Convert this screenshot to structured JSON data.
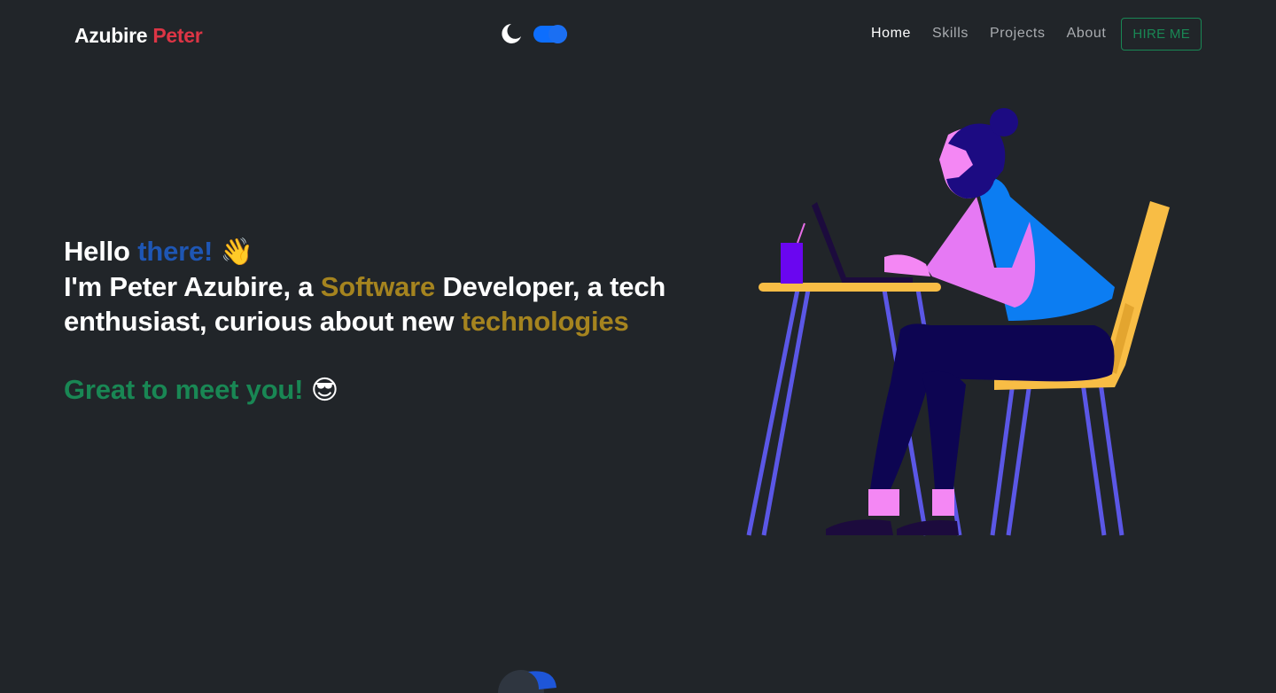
{
  "brand": {
    "first": "Azubire",
    "last": "Peter"
  },
  "theme_toggle": {
    "icon": "moon-icon",
    "state": "on",
    "color": "#0d6efd"
  },
  "nav": {
    "items": [
      {
        "label": "Home",
        "active": true
      },
      {
        "label": "Skills",
        "active": false
      },
      {
        "label": "Projects",
        "active": false
      },
      {
        "label": "About",
        "active": false
      }
    ],
    "hire_label": "HIRE ME"
  },
  "hero": {
    "hello": "Hello",
    "there": "there!",
    "wave_emoji": "👋",
    "intro_1": "I'm Peter Azubire, a",
    "software": "Software",
    "intro_2": "Developer, a tech enthusiast, curious about new",
    "technologies": "technologies",
    "meet": "Great to meet you!",
    "cool_emoji": "😎"
  },
  "colors": {
    "background": "#212529",
    "accent_red": "#dc3545",
    "accent_blue": "#1e56b4",
    "accent_gold": "#a5841f",
    "accent_green": "#198754"
  },
  "illustration": {
    "name": "developer-at-desk-illustration"
  }
}
